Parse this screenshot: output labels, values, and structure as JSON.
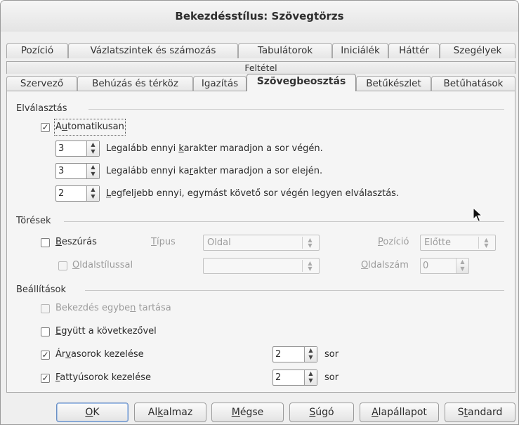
{
  "window": {
    "title": "Bekezdésstílus: Szövegtörzs"
  },
  "tabs_row1": [
    {
      "label": "Pozíció"
    },
    {
      "label": "Vázlatszintek és számozás"
    },
    {
      "label": "Tabulátorok"
    },
    {
      "label": "Iniciálék"
    },
    {
      "label": "Háttér"
    },
    {
      "label": "Szegélyek"
    }
  ],
  "tab_condition": {
    "label": "Feltétel"
  },
  "tabs_row3": [
    {
      "label": "Szervező"
    },
    {
      "label": "Behúzás és térköz"
    },
    {
      "label": "Igazítás"
    },
    {
      "label": "Szövegbeosztás"
    },
    {
      "label": "Betűkészlet"
    },
    {
      "label": "Betűhatások"
    }
  ],
  "hyphenation": {
    "section": "Elválasztás",
    "automatic": {
      "label_pre": "A",
      "label_u": "u",
      "label_post": "tomatikusan",
      "checked": "✓"
    },
    "end_chars": {
      "value": "3",
      "pre": "Legalább ennyi ",
      "u": "k",
      "post": "arakter maradjon a sor végén."
    },
    "start_chars": {
      "value": "3",
      "pre": "Legalább ennyi ka",
      "u": "r",
      "post": "akter maradjon a sor elején."
    },
    "max_consecutive": {
      "value": "2",
      "pre": "",
      "u": "L",
      "post": "egfeljebb ennyi, egymást követő sor végén legyen elválasztás."
    }
  },
  "breaks": {
    "section": "Törések",
    "insert": {
      "u": "B",
      "post": "eszúrás"
    },
    "type_label": {
      "u": "T",
      "post": "ípus"
    },
    "type_value": "Oldal",
    "position_label": {
      "u": "P",
      "post": "ozíció"
    },
    "position_value": "Előtte",
    "with_page_style": {
      "u": "O",
      "post": "ldalstílussal"
    },
    "page_style_value": "",
    "page_number_label": {
      "u": "O",
      "post": "ldalszám"
    },
    "page_number_value": "0"
  },
  "options": {
    "section": "Beállítások",
    "keep_together": {
      "pre": "Bekezdés egybe",
      "u": "n",
      "post": " tartása"
    },
    "keep_with_next": {
      "u": "E",
      "post": "gyütt a következővel"
    },
    "orphan": {
      "pre": "Ár",
      "u": "v",
      "post": "asorok kezelése",
      "checked": "✓",
      "value": "2",
      "unit": "sor"
    },
    "widow": {
      "pre": "",
      "u": "F",
      "post": "attyúsorok kezelése",
      "checked": "✓",
      "value": "2",
      "unit": "sor"
    }
  },
  "buttons": {
    "ok": {
      "u": "O",
      "post": "K"
    },
    "apply": {
      "pre": "Al",
      "u": "k",
      "post": "almaz"
    },
    "cancel": {
      "u": "M",
      "post": "égse"
    },
    "help": {
      "u": "S",
      "post": "úgó"
    },
    "reset": {
      "u": "A",
      "post": "lapállapot"
    },
    "standard": {
      "pre": "S",
      "u": "t",
      "post": "andard"
    }
  },
  "spin_arrows": "▲▼",
  "combo_arrows": "▲▼"
}
